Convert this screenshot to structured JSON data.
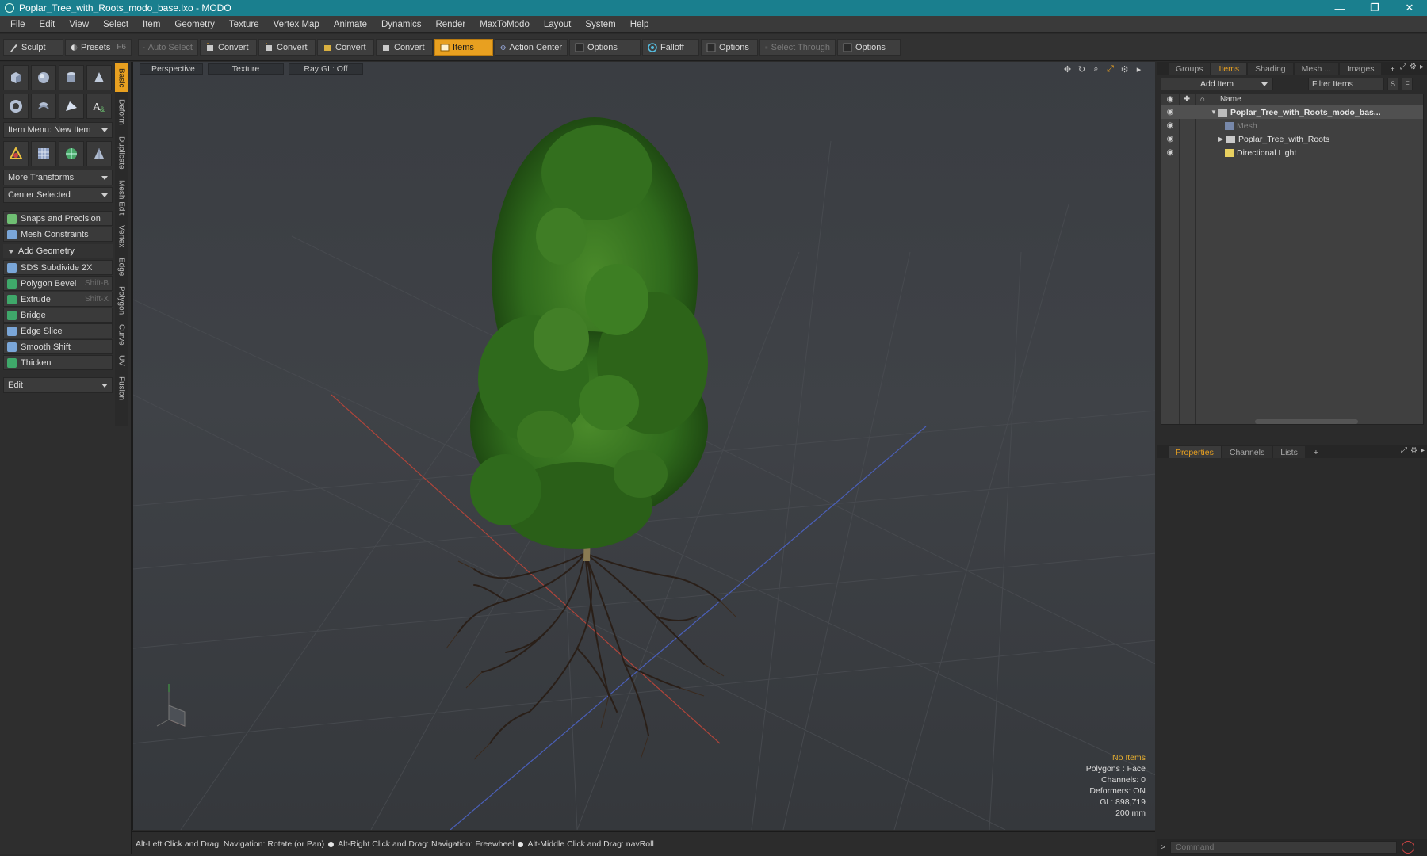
{
  "window": {
    "title": "Poplar_Tree_with_Roots_modo_base.lxo - MODO",
    "controls": [
      "—",
      "❐",
      "✕"
    ]
  },
  "menu": [
    "File",
    "Edit",
    "View",
    "Select",
    "Item",
    "Geometry",
    "Texture",
    "Vertex Map",
    "Animate",
    "Dynamics",
    "Render",
    "MaxToModo",
    "Layout",
    "System",
    "Help"
  ],
  "toolbar": {
    "sculpt": "Sculpt",
    "presets": "Presets",
    "presets_key": "F6",
    "auto_select": "Auto Select",
    "convert1": "Convert",
    "convert2": "Convert",
    "convert3": "Convert",
    "convert4": "Convert",
    "items": "Items",
    "action_center": "Action Center",
    "options1": "Options",
    "falloff": "Falloff",
    "options2": "Options",
    "select_through": "Select Through",
    "options3": "Options"
  },
  "left": {
    "item_menu": "Item Menu: New Item",
    "more_transforms": "More Transforms",
    "center_selected": "Center Selected",
    "snaps": "Snaps and Precision",
    "mesh_constraints": "Mesh Constraints",
    "add_geometry": "Add Geometry",
    "tools": [
      {
        "label": "SDS Subdivide 2X",
        "shortcut": "",
        "color": "#7aa6d8"
      },
      {
        "label": "Polygon Bevel",
        "shortcut": "Shift-B",
        "color": "#3fa86a"
      },
      {
        "label": "Extrude",
        "shortcut": "Shift-X",
        "color": "#3fa86a"
      },
      {
        "label": "Bridge",
        "shortcut": "",
        "color": "#3fa86a"
      },
      {
        "label": "Edge Slice",
        "shortcut": "",
        "color": "#7aa6d8"
      },
      {
        "label": "Smooth Shift",
        "shortcut": "",
        "color": "#7aa6d8"
      },
      {
        "label": "Thicken",
        "shortcut": "",
        "color": "#3fa86a"
      }
    ],
    "edit": "Edit",
    "vtabs": [
      "Basic",
      "Deform",
      "Duplicate",
      "Mesh Edit",
      "Vertex",
      "Edge",
      "Polygon",
      "Curve",
      "UV",
      "Fusion"
    ]
  },
  "viewport": {
    "view": "Perspective",
    "shading": "Texture",
    "raygl": "Ray GL: Off",
    "info": {
      "selection": "No Items",
      "polygons": "Polygons : Face",
      "channels": "Channels: 0",
      "deformers": "Deformers: ON",
      "gl": "GL: 898,719",
      "scale": "200 mm"
    }
  },
  "status": {
    "hint1": "Alt-Left Click and Drag: Navigation: Rotate (or Pan)",
    "hint2": "Alt-Right Click and Drag: Navigation: Freewheel",
    "hint3": "Alt-Middle Click and Drag: navRoll"
  },
  "right": {
    "tabs": [
      "Groups",
      "Items",
      "Shading",
      "Mesh ...",
      "Images"
    ],
    "active_tab": "Items",
    "add_item": "Add Item",
    "filter_items": "Filter Items",
    "filter_s": "S",
    "filter_f": "F",
    "col_name": "Name",
    "tree": [
      {
        "label": "Poplar_Tree_with_Roots_modo_bas...",
        "level": 0
      },
      {
        "label": "Mesh",
        "level": 1
      },
      {
        "label": "Poplar_Tree_with_Roots",
        "level": 1
      },
      {
        "label": "Directional Light",
        "level": 1
      }
    ],
    "prop_tabs": [
      "Properties",
      "Channels",
      "Lists"
    ],
    "command_placeholder": "Command"
  }
}
